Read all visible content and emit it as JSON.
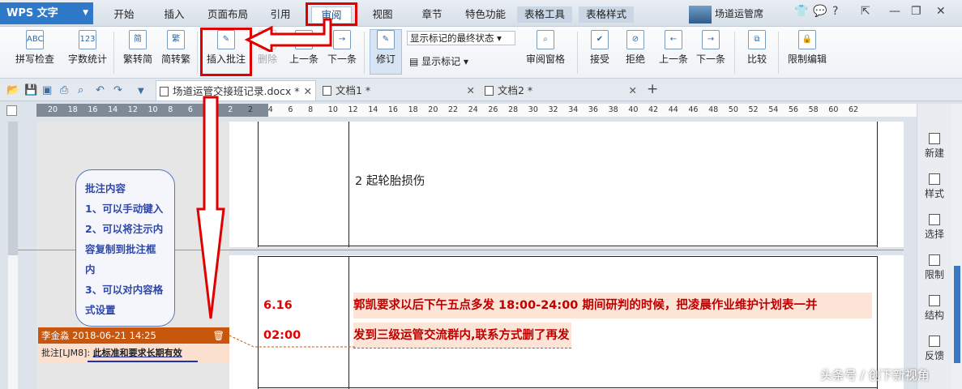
{
  "app": {
    "logo": "WPS 文字",
    "profile_name": "场道运管席"
  },
  "menu": [
    {
      "label": "开始"
    },
    {
      "label": "插入"
    },
    {
      "label": "页面布局"
    },
    {
      "label": "引用"
    },
    {
      "label": "审阅"
    },
    {
      "label": "视图"
    },
    {
      "label": "章节"
    },
    {
      "label": "特色功能"
    },
    {
      "label": "表格工具"
    },
    {
      "label": "表格样式"
    }
  ],
  "ribbon": {
    "spell": "拼写检查",
    "wordcount": "字数统计",
    "trad": "繁转简",
    "simp": "简转繁",
    "insert_comment": "插入批注",
    "delete": "删除",
    "prev": "上一条",
    "next": "下一条",
    "track": "修订",
    "markup_state": "显示标记的最终状态",
    "show_markup": "显示标记",
    "review_pane": "审阅窗格",
    "accept": "接受",
    "reject": "拒绝",
    "prev2": "上一条",
    "next2": "下一条",
    "compare": "比较",
    "restrict": "限制编辑",
    "icon_abc": "ABC",
    "icon_123": "123",
    "icon_abc2": "ABC",
    "icon_jian": "简",
    "icon_fan": "繁"
  },
  "tabs": [
    {
      "label": "场道运管交接班记录.docx *"
    },
    {
      "label": "文档1 *"
    },
    {
      "label": "文档2 *"
    }
  ],
  "ruler_labels": [
    "20",
    "18",
    "16",
    "14",
    "12",
    "10",
    "8",
    "6",
    "4",
    "2",
    "2",
    "4",
    "6",
    "8",
    "10",
    "12",
    "14",
    "16",
    "18",
    "20",
    "22",
    "24",
    "26",
    "28",
    "30",
    "32",
    "34",
    "36",
    "38",
    "40",
    "42",
    "44",
    "46",
    "48",
    "50",
    "52",
    "54",
    "56",
    "58",
    "60",
    "62"
  ],
  "doc": {
    "cell1": "2 起轮胎损伤",
    "date": "6.16",
    "time": "02:00",
    "line1": "郭凯要求以后下午五点多发 18:00-24:00 期间研判的时候，把凌晨作业维护计划表一并",
    "line2": "发到三级运管交流群内,联系方式删了再发"
  },
  "annotation": {
    "title": "批注内容",
    "items": [
      "1、可以手动键入",
      "2、可以将注示内",
      "容复制到批注框",
      "内",
      "3、可以对内容格",
      "式设置"
    ]
  },
  "comment": {
    "author_date": "李金淼  2018-06-21  14:25",
    "prefix": "批注[LJM8]: ",
    "text": "此标准和要求长期有效"
  },
  "sidebar": [
    {
      "label": "新建"
    },
    {
      "label": "样式"
    },
    {
      "label": "选择"
    },
    {
      "label": "限制"
    },
    {
      "label": "结构"
    },
    {
      "label": "反馈"
    }
  ],
  "watermark": "头条号 / 创下新视角",
  "colors": {
    "accent": "#2f7ac8",
    "highlight_red": "#e00000",
    "comment_head": "#c8560c"
  }
}
